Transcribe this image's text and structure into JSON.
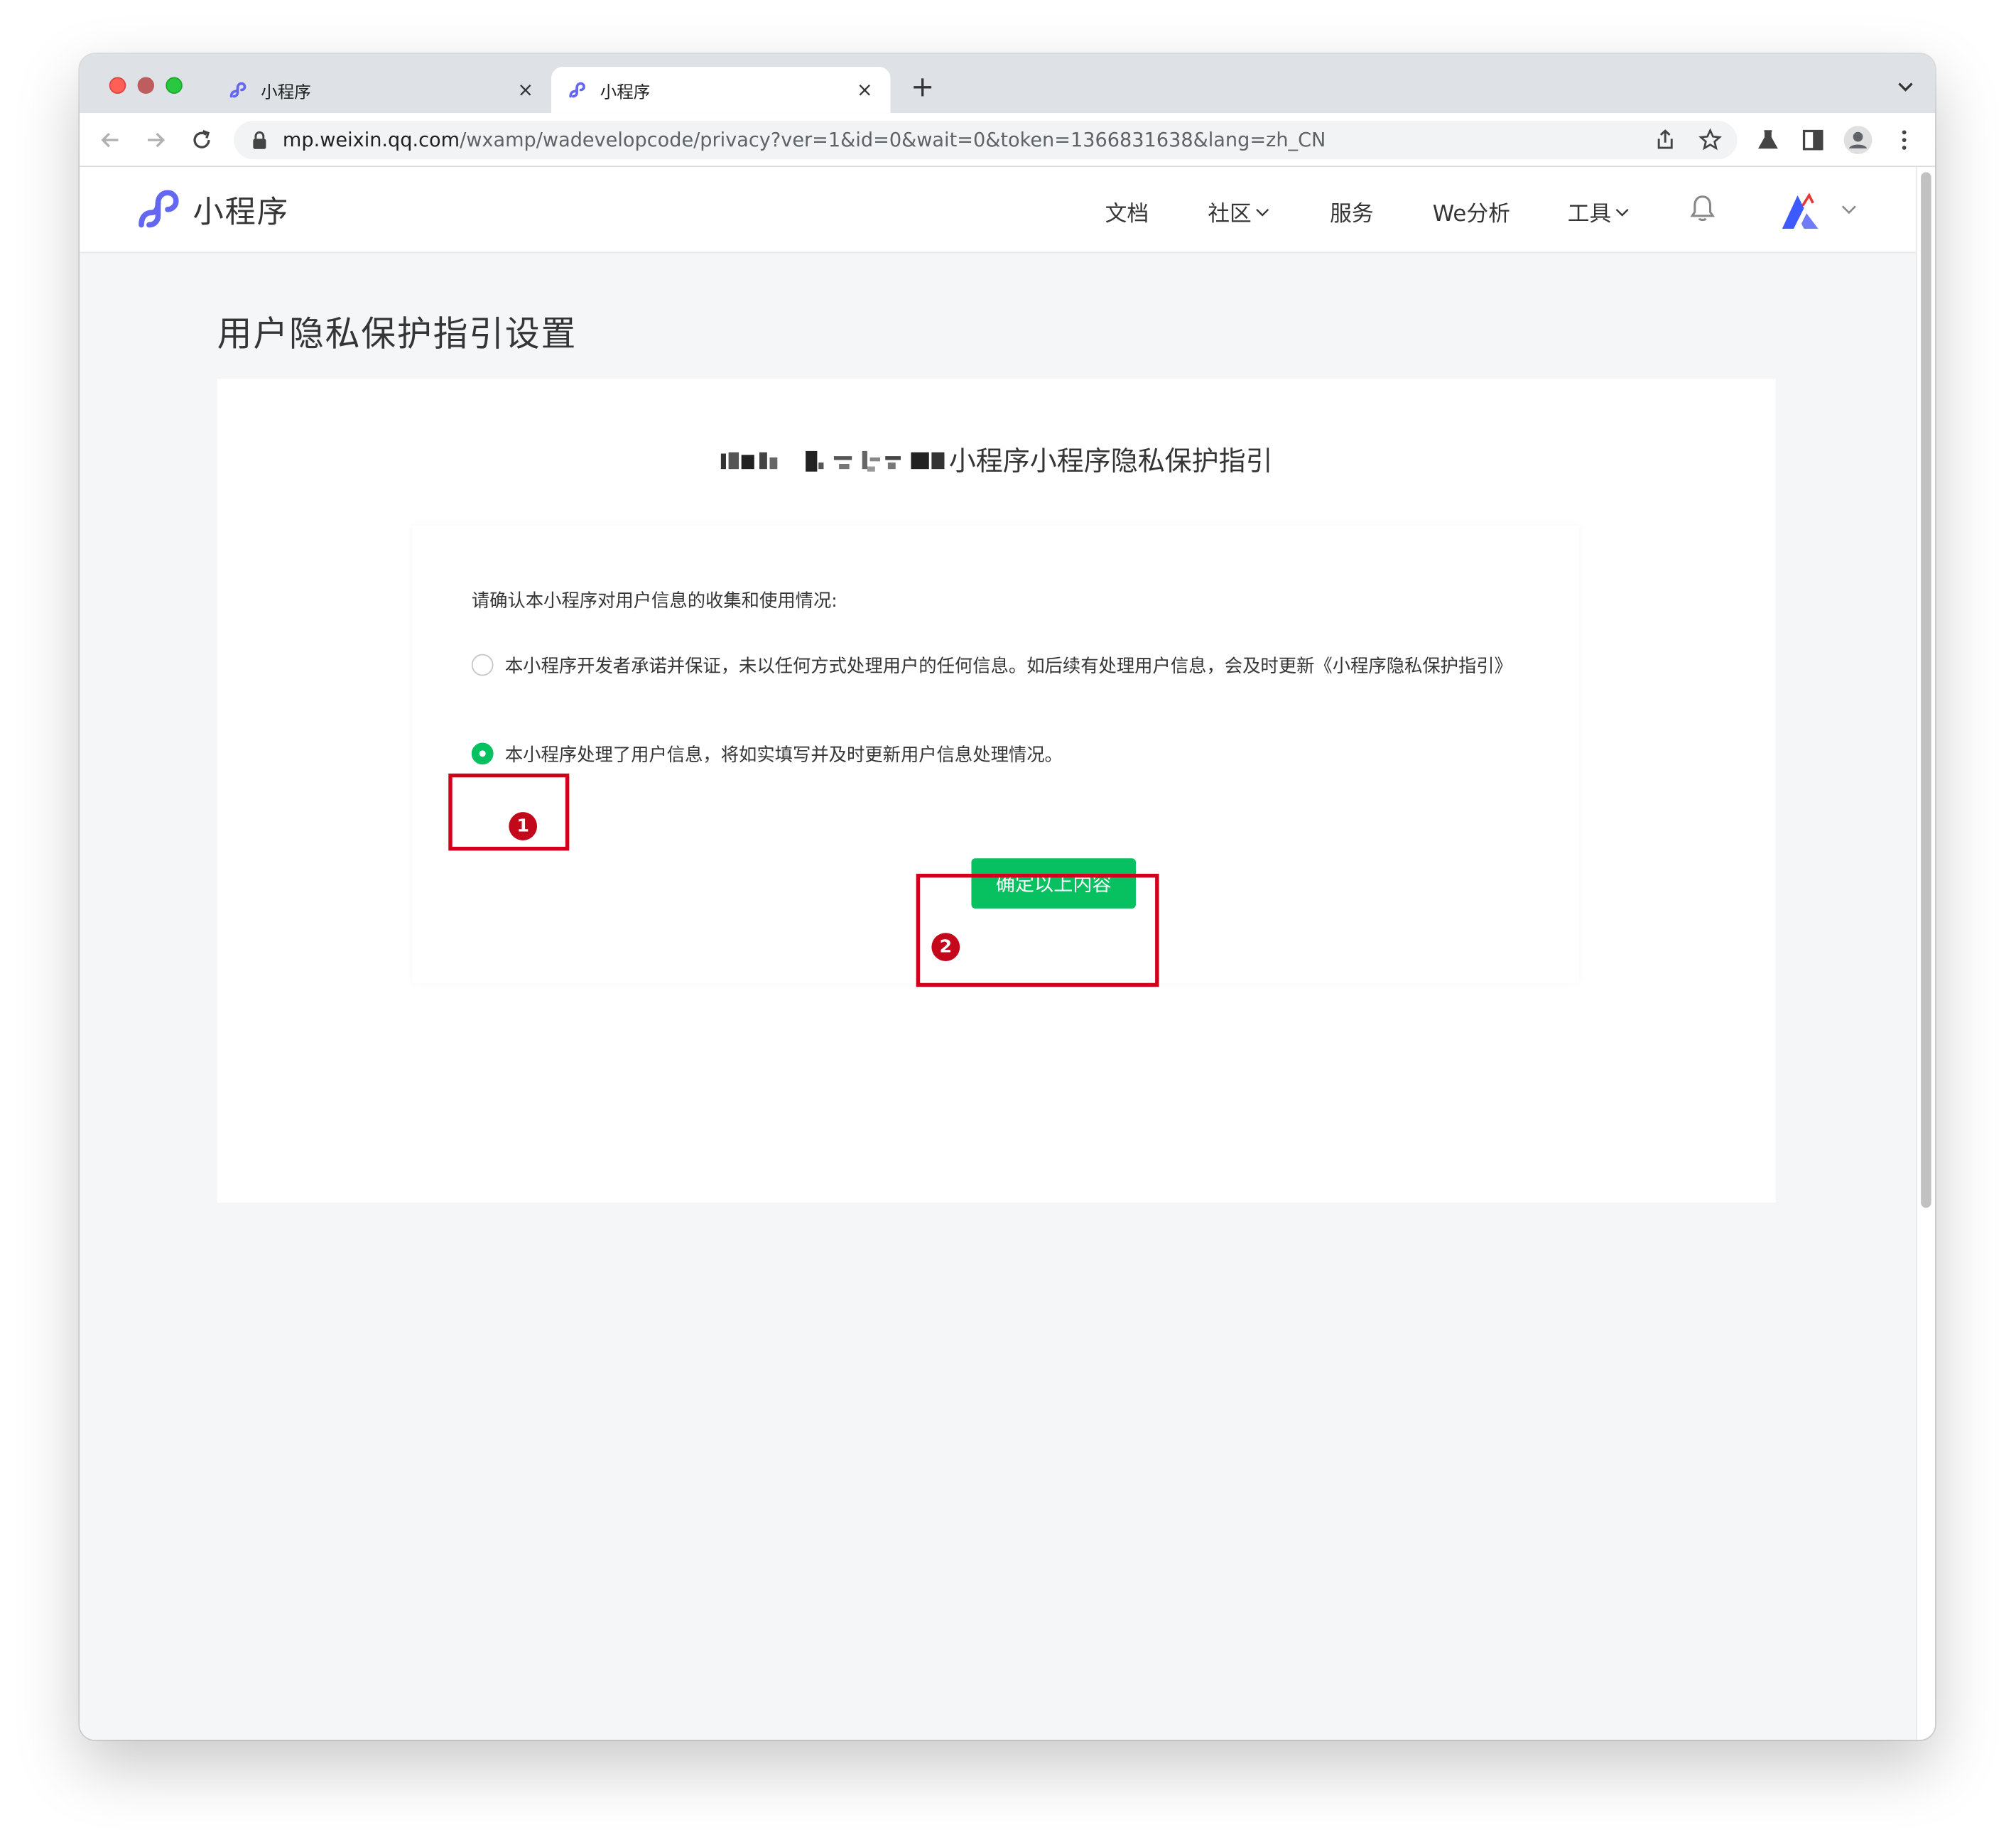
{
  "browser": {
    "tabs": [
      {
        "title": "小程序",
        "active": false
      },
      {
        "title": "小程序",
        "active": true
      }
    ],
    "url_host": "mp.weixin.qq.com",
    "url_path": "/wxamp/wadevelopcode/privacy?ver=1&id=0&wait=0&token=1366831638&lang=zh_CN",
    "new_tab_label": "+",
    "close_glyph": "×"
  },
  "header": {
    "brand_name": "小程序",
    "nav": {
      "docs": "文档",
      "community": "社区",
      "services": "服务",
      "analytics": "We分析",
      "tools": "工具"
    }
  },
  "page": {
    "title": "用户隐私保护指引设置",
    "card_title": "小程序小程序隐私保护指引",
    "prompt": "请确认本小程序对用户信息的收集和使用情况:",
    "options": [
      {
        "label": "本小程序开发者承诺并保证，未以任何方式处理用户的任何信息。如后续有处理用户信息，会及时更新《小程序隐私保护指引》",
        "checked": false
      },
      {
        "label": "本小程序处理了用户信息，将如实填写并及时更新用户信息处理情况。",
        "checked": true
      }
    ],
    "confirm_button": "确定以上内容"
  },
  "annotations": {
    "marker_1": "1",
    "marker_2": "2"
  },
  "colors": {
    "accent_green": "#07c160",
    "brand_purple": "#6467f0",
    "annotation_red": "#d0021b"
  }
}
